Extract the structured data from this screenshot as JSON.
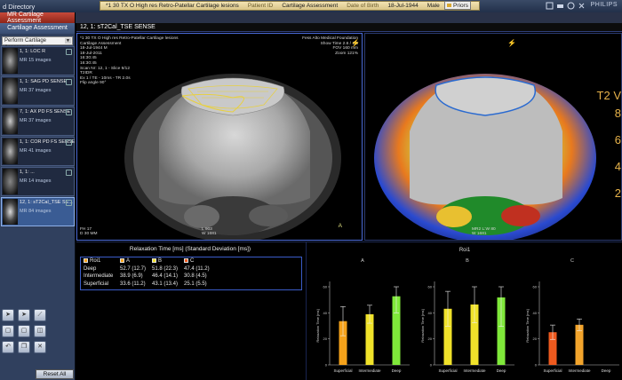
{
  "topbar": {
    "directory": "d Directory",
    "series_title": "*1 30 TX O High res Retro-Patellar Cartilage lesions",
    "patient_id_label": "Patient ID",
    "patient_id_value": "Cartilage Assessment",
    "dob_label": "Date of Birth",
    "dob_value": "18-Jul-1944",
    "sex": "Male",
    "priors_label": "Priors",
    "brand": "PHILIPS"
  },
  "tabs": {
    "active_label": "MR Cartilage Assessment"
  },
  "left_panel": {
    "title": "Cartilage Assessment",
    "dropdown_value": "Perform Cartilage Assessment",
    "series": [
      {
        "title": "1, 1: LOC R",
        "images": "MR 15 images"
      },
      {
        "title": "1, 1: SAG PD SENSE",
        "images": "MR 37 images"
      },
      {
        "title": "7, 1: AX PD FS SENSE",
        "images": "MR 37 images"
      },
      {
        "title": "1, 1: COR PD FS SENSE",
        "images": "MR 41 images"
      },
      {
        "title": "1, 1: ...",
        "images": "MR 14 images"
      },
      {
        "title": "12, 1: sT2Cal_TSE SE...",
        "images": "MR 84 images"
      }
    ],
    "reset_label": "Reset All"
  },
  "viewports": {
    "header": "12, 1: sT2Cal_TSE SENSE",
    "left": {
      "top_left": [
        "*1 30 TX O High res Retro-Patellar Cartilage lesions",
        "Cartilage Assessment",
        "18-Jul-1944 M",
        "18-Jul-2011",
        "16:30:45",
        "16:30:45",
        "Scan Nr: 12, 1 - Slice 9/12",
        "T2IDR",
        "Ex 1 / TE - 10ms - TR 2.0s",
        "Flip angle 90°"
      ],
      "top_right": [
        "Fess Alto Medical Foundation",
        "Show Time 2.6 / 1.0",
        "FOV 160 mm",
        "Zoom 121%"
      ],
      "bottom_left": [
        "FH 17",
        "D 30 MM"
      ],
      "bottom_mid": [
        "L 903",
        "W 1681"
      ],
      "orient": {
        "top": "A",
        "left": "R",
        "right": "L",
        "bottom": "P"
      }
    },
    "right": {
      "bottom_mid": [
        "MR2 L:W 80",
        "W 1681"
      ],
      "scale_title": "T2 V",
      "scale_values": [
        "8",
        "6",
        "4",
        "2"
      ]
    }
  },
  "relaxation": {
    "title": "Relaxation Time [ms] (Standard Deviation [ms])",
    "header": {
      "roi": "Roi1",
      "a": "A",
      "b": "B",
      "c": "C"
    },
    "rows": [
      {
        "label": "Deep",
        "a": "52.7 (12.7)",
        "b": "51.8 (22.3)",
        "c": "47.4 (11.2)"
      },
      {
        "label": "Intermediate",
        "a": "38.9 (6.9)",
        "b": "46.4 (14.1)",
        "c": "30.8 (4.5)"
      },
      {
        "label": "Superficial",
        "a": "33.6 (11.2)",
        "b": "43.1 (13.4)",
        "c": "25.1 (5.5)"
      }
    ]
  },
  "colors": {
    "panel_blue": "#30405e",
    "tab_red": "#b5392a",
    "superficial": "#f5a21a",
    "intermediate": "#f0e22a",
    "deep": "#7fe83a",
    "c_superficial": "#ee5a1e",
    "c_intermediate": "#f2a42c"
  },
  "chart_data": {
    "type": "bar",
    "title": "Roi1",
    "ylabel": "Relaxation Time [ms]",
    "ylim": [
      0,
      60
    ],
    "categories": [
      "Superficial",
      "Intermediate",
      "Deep"
    ],
    "panels": [
      {
        "name": "A",
        "values": [
          33.6,
          38.9,
          52.7
        ],
        "sd": [
          11.2,
          6.9,
          12.7
        ],
        "colors": [
          "#f5a21a",
          "#f0e22a",
          "#7fe83a"
        ]
      },
      {
        "name": "B",
        "values": [
          43.1,
          46.4,
          51.8
        ],
        "sd": [
          13.4,
          14.1,
          22.3
        ],
        "colors": [
          "#f0e22a",
          "#f0e22a",
          "#7fe83a"
        ]
      },
      {
        "name": "C",
        "values": [
          25.1,
          30.8
        ],
        "sd": [
          5.5,
          4.5
        ],
        "colors": [
          "#ee5a1e",
          "#f2a42c"
        ]
      }
    ]
  }
}
